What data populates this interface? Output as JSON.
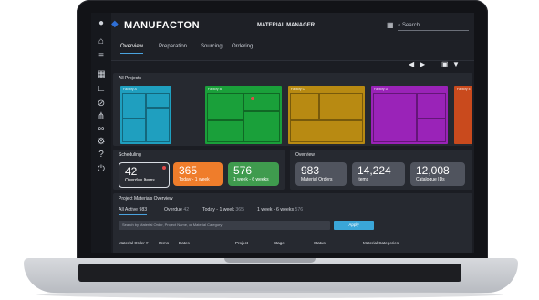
{
  "header": {
    "brand": "MANUFACTON",
    "app_title": "MATERIAL MANAGER",
    "search_placeholder": "Search"
  },
  "tabs": [
    {
      "label": "Overview"
    },
    {
      "label": "Preparation"
    },
    {
      "label": "Sourcing"
    },
    {
      "label": "Ordering"
    }
  ],
  "sidebar": {
    "icons": [
      "home-icon",
      "list-icon",
      "boxes-icon",
      "angle-icon",
      "cancel-icon",
      "hierarchy-icon",
      "link-icon",
      "gear-icon",
      "help-icon",
      "power-icon"
    ]
  },
  "projects": {
    "title": "All Projects",
    "cards": [
      {
        "label": "Factory A",
        "color": "#1f9fbf"
      },
      {
        "label": "Factory B",
        "color": "#1aa03a"
      },
      {
        "label": "Factory C",
        "color": "#b88a12"
      },
      {
        "label": "Factory D",
        "color": "#9a23b8"
      },
      {
        "label": "Factory E",
        "color": "#c94a1d"
      }
    ]
  },
  "scheduling": {
    "title": "Scheduling",
    "items": [
      {
        "num": "42",
        "cap": "Overdue Items",
        "color": "#2a2d34"
      },
      {
        "num": "365",
        "cap": "Today - 1 week",
        "color": "#ef7d2b"
      },
      {
        "num": "576",
        "cap": "1 week - 6 weeks",
        "color": "#3f9b4e"
      }
    ]
  },
  "overview": {
    "title": "Overview",
    "items": [
      {
        "num": "983",
        "cap": "Material Orders"
      },
      {
        "num": "14,224",
        "cap": "Items"
      },
      {
        "num": "12,008",
        "cap": "Catalogue IDs"
      }
    ]
  },
  "pmo": {
    "title": "Project Materials Overview",
    "filters": [
      {
        "label": "All Active",
        "count": "983"
      },
      {
        "label": "Overdue",
        "count": "42"
      },
      {
        "label": "Today - 1 week",
        "count": "365"
      },
      {
        "label": "1 week - 6 weeks",
        "count": "576"
      }
    ],
    "search_placeholder": "Search by Material Order, Project Name, or Material Category",
    "apply": "Apply",
    "columns": [
      "Material Order #",
      "Items",
      "Dates",
      "Project",
      "Stage",
      "Status",
      "Material Categories"
    ]
  }
}
